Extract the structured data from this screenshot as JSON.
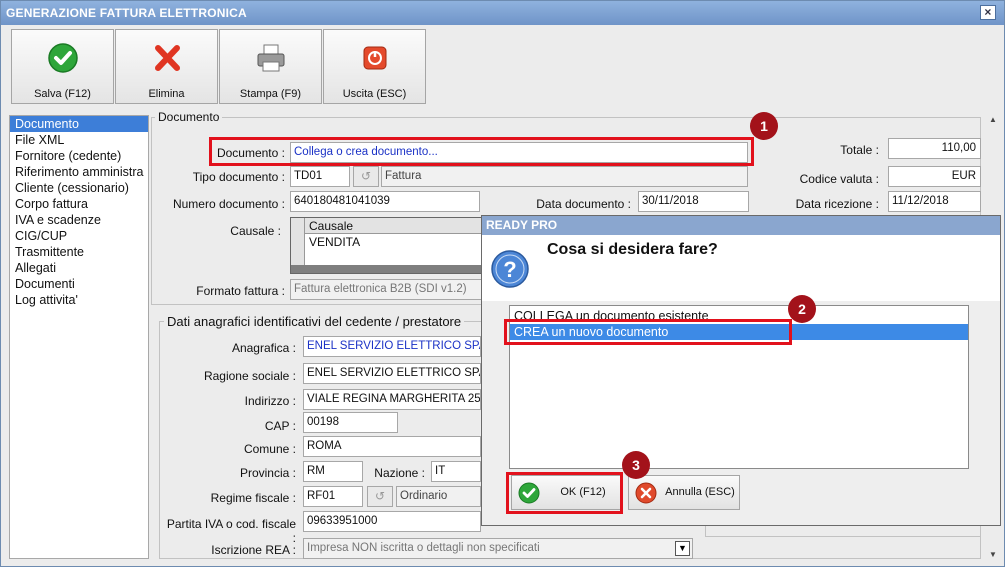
{
  "window": {
    "title": "GENERAZIONE FATTURA ELETTRONICA",
    "close_glyph": "×"
  },
  "toolbar": {
    "save_label": "Salva (F12)",
    "delete_label": "Elimina",
    "print_label": "Stampa (F9)",
    "exit_label": "Uscita (ESC)"
  },
  "nav": {
    "items": [
      {
        "label": "Documento",
        "selected": true
      },
      {
        "label": "File XML"
      },
      {
        "label": "Fornitore (cedente)"
      },
      {
        "label": "Riferimento amministra"
      },
      {
        "label": "Cliente (cessionario)"
      },
      {
        "label": "Corpo fattura"
      },
      {
        "label": "IVA e scadenze"
      },
      {
        "label": "CIG/CUP"
      },
      {
        "label": "Trasmittente"
      },
      {
        "label": "Allegati"
      },
      {
        "label": "Documenti"
      },
      {
        "label": "Log attivita'"
      }
    ]
  },
  "documento": {
    "legend": "Documento",
    "documento_label": "Documento :",
    "documento_value": "Collega o crea documento...",
    "tipo_label": "Tipo documento :",
    "tipo_code": "TD01",
    "tipo_desc": "Fattura",
    "numero_label": "Numero documento :",
    "numero_value": "640180481041039",
    "data_label": "Data documento :",
    "data_value": "30/11/2018",
    "causale_label": "Causale :",
    "causale_header": "Causale",
    "causale_row": "VENDITA",
    "formato_label": "Formato fattura :",
    "formato_value": "Fattura elettronica B2B (SDI v1.2)",
    "totale_label": "Totale :",
    "totale_value": "110,00",
    "valuta_label": "Codice valuta :",
    "valuta_value": "EUR",
    "ricezione_label": "Data ricezione :",
    "ricezione_value": "11/12/2018"
  },
  "cedente": {
    "legend": "Dati anagrafici identificativi del cedente / prestatore",
    "anagrafica_label": "Anagrafica :",
    "anagrafica_value": "ENEL SERVIZIO ELETTRICO SPA",
    "ragione_label": "Ragione sociale :",
    "ragione_value": "ENEL SERVIZIO ELETTRICO SPA",
    "indirizzo_label": "Indirizzo :",
    "indirizzo_value": "VIALE REGINA MARGHERITA 25",
    "cap_label": "CAP :",
    "cap_value": "00198",
    "comune_label": "Comune :",
    "comune_value": "ROMA",
    "provincia_label": "Provincia :",
    "provincia_value": "RM",
    "nazione_label": "Nazione :",
    "nazione_value": "IT",
    "regime_label": "Regime fiscale :",
    "regime_code": "RF01",
    "regime_desc": "Ordinario",
    "piva_label": "Partita IVA o cod. fiscale :",
    "piva_value": "09633951000",
    "rea_label": "Iscrizione REA :",
    "rea_value": "Impresa NON iscritta o dettagli non specificati"
  },
  "dialog": {
    "title": "READY PRO",
    "question": "Cosa si desidera fare?",
    "options": [
      {
        "label": "COLLEGA un documento esistente"
      },
      {
        "label": "CREA un nuovo documento",
        "selected": true
      }
    ],
    "ok_label": "OK (F12)",
    "cancel_label": "Annulla (ESC)"
  },
  "annotations": {
    "badge1": "1",
    "badge2": "2",
    "badge3": "3"
  },
  "colors": {
    "highlight_red": "#e2111c",
    "badge": "#a3121a",
    "selection": "#3d8ae6"
  }
}
